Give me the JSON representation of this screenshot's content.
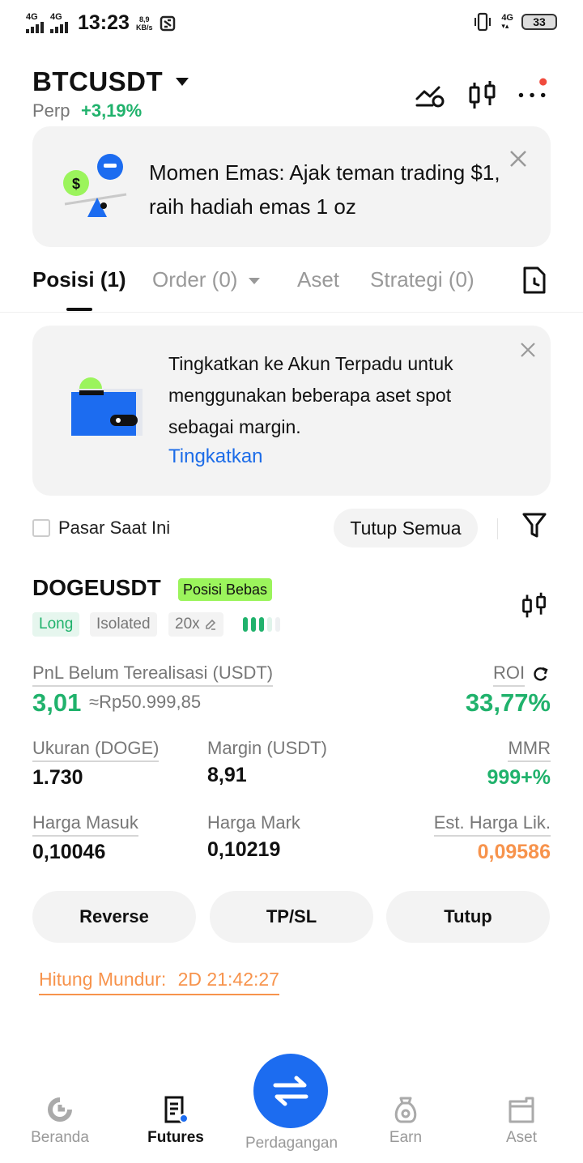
{
  "status_bar": {
    "network1": "4G",
    "network2": "4G",
    "time": "13:23",
    "speed_value": "8,9",
    "speed_unit": "KB/s",
    "network3": "4G",
    "battery": "33"
  },
  "header": {
    "pair": "BTCUSDT",
    "type": "Perp",
    "change": "+3,19%",
    "icons": [
      "chart-line-icon",
      "candlestick-icon",
      "more-icon"
    ]
  },
  "promo_banner": {
    "text": "Momen Emas: Ajak teman trading $1, raih hadiah emas 1 oz"
  },
  "tabs": {
    "positions": "Posisi (1)",
    "orders": "Order (0)",
    "assets": "Aset",
    "strategies": "Strategi (0)"
  },
  "upgrade_banner": {
    "text": "Tingkatkan ke Akun Terpadu untuk menggunakan beberapa aset spot sebagai margin.",
    "link": "Tingkatkan"
  },
  "filters": {
    "current_market_label": "Pasar Saat Ini",
    "close_all": "Tutup Semua"
  },
  "position": {
    "symbol": "DOGEUSDT",
    "badge": "Posisi Bebas",
    "side": "Long",
    "margin_mode": "Isolated",
    "leverage": "20x",
    "pnl_label": "PnL Belum Terealisasi (USDT)",
    "pnl_value": "3,01",
    "pnl_idr": "≈Rp50.999,85",
    "roi_label": "ROI",
    "roi_value": "33,77%",
    "size_label": "Ukuran (DOGE)",
    "size_value": "1.730",
    "margin_label": "Margin (USDT)",
    "margin_value": "8,91",
    "mmr_label": "MMR",
    "mmr_value": "999+%",
    "entry_label": "Harga Masuk",
    "entry_value": "0,10046",
    "mark_label": "Harga Mark",
    "mark_value": "0,10219",
    "liq_label": "Est. Harga Lik.",
    "liq_value": "0,09586"
  },
  "actions": {
    "reverse": "Reverse",
    "tpsl": "TP/SL",
    "close": "Tutup"
  },
  "countdown": {
    "label": "Hitung Mundur:",
    "value": "2D 21:42:27"
  },
  "nav": {
    "home": "Beranda",
    "futures": "Futures",
    "trade": "Perdagangan",
    "earn": "Earn",
    "assets": "Aset"
  },
  "colors": {
    "green": "#20b26c",
    "orange": "#f7934c",
    "blue": "#1c6cf0",
    "badge_green": "#9bf45c"
  }
}
